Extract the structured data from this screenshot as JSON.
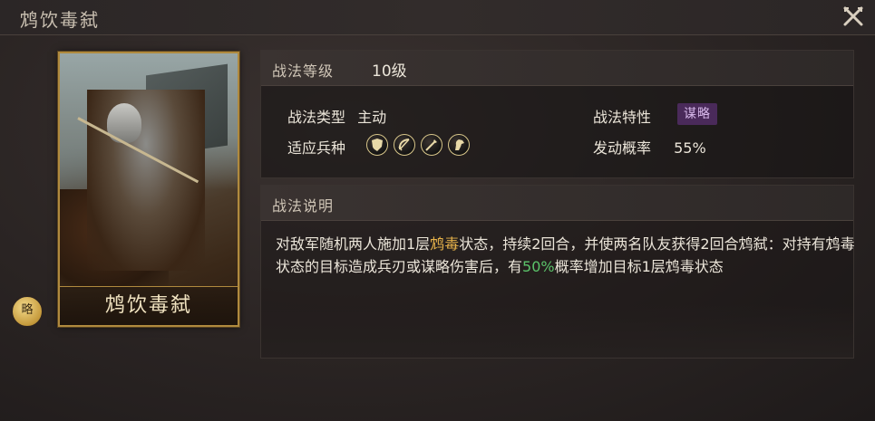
{
  "window": {
    "title": "鸩饮毒弑"
  },
  "card": {
    "name": "鸩饮毒弑",
    "type_badge": "略"
  },
  "skill": {
    "level_label": "战法等级",
    "level_value": "10级",
    "type_label": "战法类型",
    "type_value": "主动",
    "troops_label": "适应兵种",
    "troops": [
      "shield-icon",
      "bow-icon",
      "spear-icon",
      "horse-icon"
    ],
    "trait_label": "战法特性",
    "trait_value": "谋略",
    "rate_label": "发动概率",
    "rate_value": "55%"
  },
  "description": {
    "header": "战法说明",
    "seg1": "对敌军随机两人施加1层",
    "seg2": "鸩毒",
    "seg3": "状态，持续2回合，并使两名队友获得2回合鸩弑：对持有鸩毒状态的目标造成兵刃或谋略伤害后，有",
    "seg4": "50%",
    "seg5": "概率增加目标1层鸩毒状态"
  },
  "colors": {
    "accent_gold": "#e7b24a",
    "accent_green": "#5bc36a",
    "trait_tag_bg": "#4a2a5a",
    "frame_gold": "#b08a3e"
  }
}
